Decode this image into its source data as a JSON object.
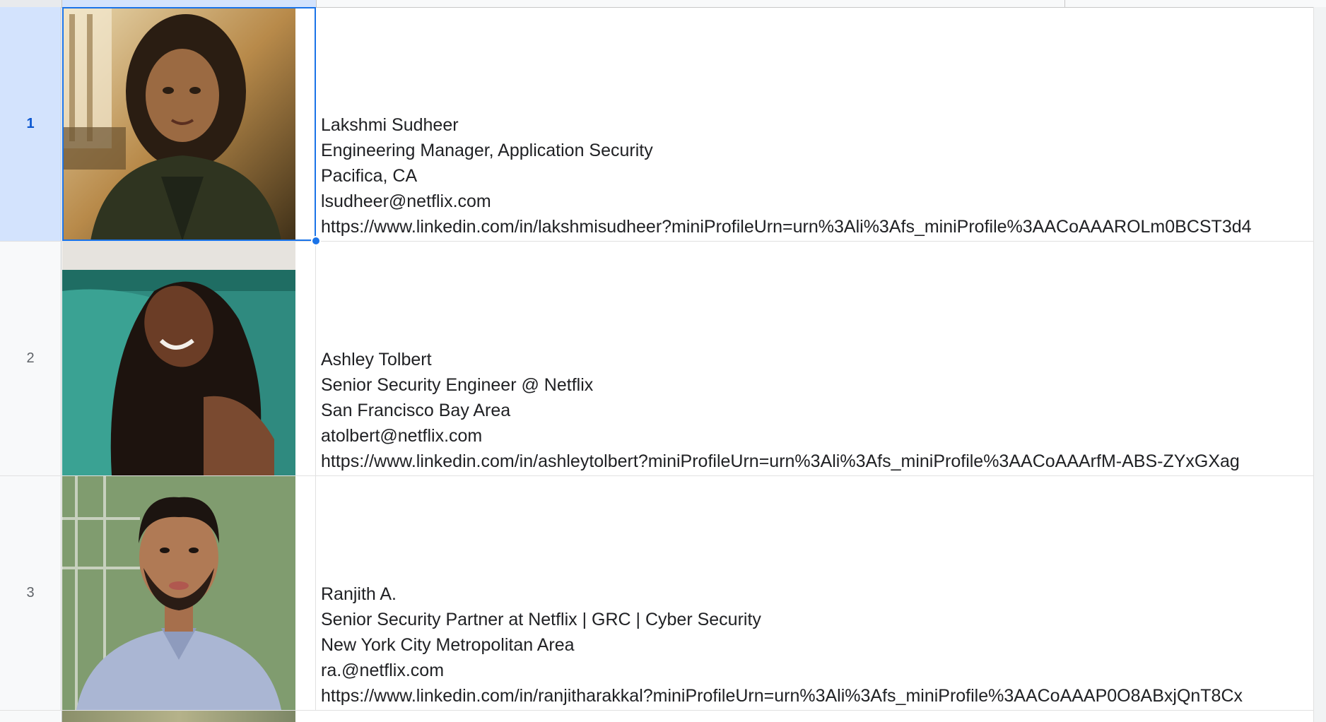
{
  "sheet": {
    "rows": [
      {
        "number": "1",
        "selected": true,
        "name": "Lakshmi Sudheer",
        "title": "Engineering Manager, Application Security",
        "location": "Pacifica, CA",
        "email": "lsudheer@netflix.com",
        "url": "https://www.linkedin.com/in/lakshmisudheer?miniProfileUrn=urn%3Ali%3Afs_miniProfile%3AACoAAAROLm0BCST3d4"
      },
      {
        "number": "2",
        "selected": false,
        "name": "Ashley Tolbert",
        "title": "Senior Security Engineer @ Netflix",
        "location": "San Francisco Bay Area",
        "email": "atolbert@netflix.com",
        "url": "https://www.linkedin.com/in/ashleytolbert?miniProfileUrn=urn%3Ali%3Afs_miniProfile%3AACoAAArfM-ABS-ZYxGXag"
      },
      {
        "number": "3",
        "selected": false,
        "name": "Ranjith A.",
        "title": "Senior Security Partner at Netflix | GRC | Cyber Security",
        "location": "New York City Metropolitan Area",
        "email": "ra.@netflix.com",
        "url": "https://www.linkedin.com/in/ranjitharakkal?miniProfileUrn=urn%3Ali%3Afs_miniProfile%3AACoAAAP0O8ABxjQnT8Cx"
      }
    ]
  },
  "colors": {
    "selection": "#1a73e8",
    "selected_header": "#d3e3fd",
    "gridline": "#e1e1e1"
  }
}
